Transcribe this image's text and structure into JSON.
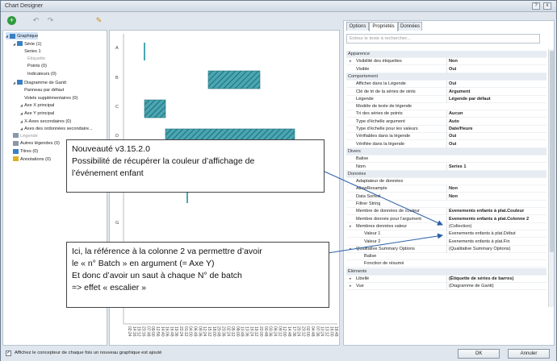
{
  "window": {
    "title": "Chart Designer",
    "buttons": [
      "?",
      "x"
    ]
  },
  "toolbar": {
    "icons": [
      "add-icon",
      "undo-icon",
      "redo-icon",
      "wizard-icon"
    ]
  },
  "tree": [
    {
      "label": "Graphique",
      "indent": 0,
      "icon": "chart",
      "selected": true
    },
    {
      "label": "Série (1)",
      "indent": 1,
      "icon": "series"
    },
    {
      "label": "Series 1",
      "indent": 2
    },
    {
      "label": "Etiquette",
      "indent": 3,
      "muted": true
    },
    {
      "label": "Points (0)",
      "indent": 3
    },
    {
      "label": "Indicateurs (0)",
      "indent": 3
    },
    {
      "label": "Diagramme de Gantt",
      "indent": 1,
      "icon": "gantt"
    },
    {
      "label": "Panneau par défaut",
      "indent": 2
    },
    {
      "label": "Volets supplémentaires (0)",
      "indent": 2
    },
    {
      "label": "Axe X principal",
      "indent": 2
    },
    {
      "label": "Axe Y principal",
      "indent": 2
    },
    {
      "label": "X-Axes secondaires (0)",
      "indent": 2
    },
    {
      "label": "Axes des ordonnées secondaire...",
      "indent": 2
    },
    {
      "label": "Légende",
      "indent": 1,
      "icon": "legend",
      "muted": true
    },
    {
      "label": "Autres légendes (0)",
      "indent": 1,
      "icon": "legend"
    },
    {
      "label": "Titres (0)",
      "indent": 1,
      "icon": "title"
    },
    {
      "label": "Annotations (0)",
      "indent": 1,
      "icon": "annotation"
    }
  ],
  "chart": {
    "rows": [
      "A",
      "B",
      "C",
      "D",
      "",
      "",
      "G"
    ],
    "xticks": [
      "02:24",
      "14:16",
      "19:12",
      "23:16",
      "07:48",
      "09:00",
      "12:56",
      "14:40",
      "16:06",
      "16:48",
      "19:36",
      "22:24",
      "01:12",
      "04:00",
      "06:48",
      "09:36",
      "12:24",
      "15:12",
      "18:00",
      "20:48",
      "23:36",
      "02:24",
      "05:12",
      "08:00",
      "10:48",
      "13:36",
      "16:24",
      "19:12",
      "22:00",
      "00:48",
      "03:36",
      "06:24",
      "09:12",
      "12:00",
      "14:48",
      "17:36",
      "20:24",
      "23:12",
      "02:00",
      "04:48",
      "07:36",
      "10:24",
      "13:12",
      "16:00",
      "18:48"
    ]
  },
  "tabs": [
    "Options",
    "Propriétés",
    "Données"
  ],
  "active_tab": "Propriétés",
  "search_placeholder": "Entrez le texte à rechercher...",
  "properties": [
    {
      "key": "Apparence",
      "cat": true
    },
    {
      "key": "Visibilité des étiquettes",
      "value": "Non",
      "bold": true,
      "exp": true
    },
    {
      "key": "Visible",
      "value": "Oui",
      "bold": true
    },
    {
      "key": "Comportement",
      "cat": true
    },
    {
      "key": "Afficher dans la Légende",
      "value": "Oui",
      "bold": true
    },
    {
      "key": "Clé de tri de la séries de oints",
      "value": "Argument",
      "bold": true
    },
    {
      "key": "Légende",
      "value": "Légende par défaut",
      "bold": true
    },
    {
      "key": "Modèle de texte de légende",
      "value": ""
    },
    {
      "key": "Tri des séries de points",
      "value": "Aucun",
      "bold": true
    },
    {
      "key": "Type d'échelle argument",
      "value": "Auto",
      "bold": true
    },
    {
      "key": "Type d'échelle pour les valeurs",
      "value": "Date/Heure",
      "bold": true
    },
    {
      "key": "Vérifiables dans la légende",
      "value": "Oui",
      "bold": true
    },
    {
      "key": "Vérifiée dans la légende",
      "value": "Oui",
      "bold": true
    },
    {
      "key": "Divers",
      "cat": true
    },
    {
      "key": "Balise",
      "value": ""
    },
    {
      "key": "Nom",
      "value": "Series 1",
      "bold": true
    },
    {
      "key": "Données",
      "cat": true
    },
    {
      "key": "Adaptateur de données",
      "value": ""
    },
    {
      "key": "AllowResample",
      "value": "Non",
      "bold": true
    },
    {
      "key": "Data Sorted",
      "value": "Non",
      "bold": true
    },
    {
      "key": "Filtrer String",
      "value": ""
    },
    {
      "key": "Membre de données de couleur",
      "value": "Evenements enfants à plat.Couleur",
      "bold": true
    },
    {
      "key": "Membre donnée pour l'argument",
      "value": "Evenements enfants à plat.Colonne 2",
      "bold": true
    },
    {
      "key": "Membres données valeur",
      "value": "(Collection)",
      "exp": true
    },
    {
      "key": "Valeur 1",
      "value": "Evenements enfants à plat.Début",
      "sub": true
    },
    {
      "key": "Valeur 2",
      "value": "Evenements enfants à plat.Fin",
      "sub": true
    },
    {
      "key": "Qualitative Summary Options",
      "value": "(Qualitative Summary Options)",
      "exp": true
    },
    {
      "key": "Balise",
      "value": "",
      "sub": true
    },
    {
      "key": "Fonction de résumé",
      "value": "",
      "sub": true
    },
    {
      "key": "Éléments",
      "cat": true
    },
    {
      "key": "Libellé",
      "value": "(Étiquette de séries de barres)",
      "bold": true,
      "exp": true
    },
    {
      "key": "Vue",
      "value": "(Diagramme de Gantt)",
      "exp": true
    }
  ],
  "footer": {
    "checkbox_label": "Affichez le concepteur de chaque fois un nouveau graphique est ajouté",
    "ok": "OK",
    "cancel": "Annuler"
  },
  "callout1": {
    "line1": "Nouveauté v3.15.2.0",
    "line2": "Possibilité de récupérer la couleur d’affichage de",
    "line3": "l’événement enfant"
  },
  "callout2": {
    "line1": "Ici, la référence à la colonne 2 va permettre d’avoir",
    "line2": "le « n° Batch » en argument (= Axe Y)",
    "line3": "Et donc d’avoir un saut à chaque N° de batch",
    "line4": "=> effet « escalier »"
  },
  "colors": {
    "bar": "#4aa6b2",
    "bar_dark": "#1e6e78",
    "arrow": "#2b5fa8"
  }
}
